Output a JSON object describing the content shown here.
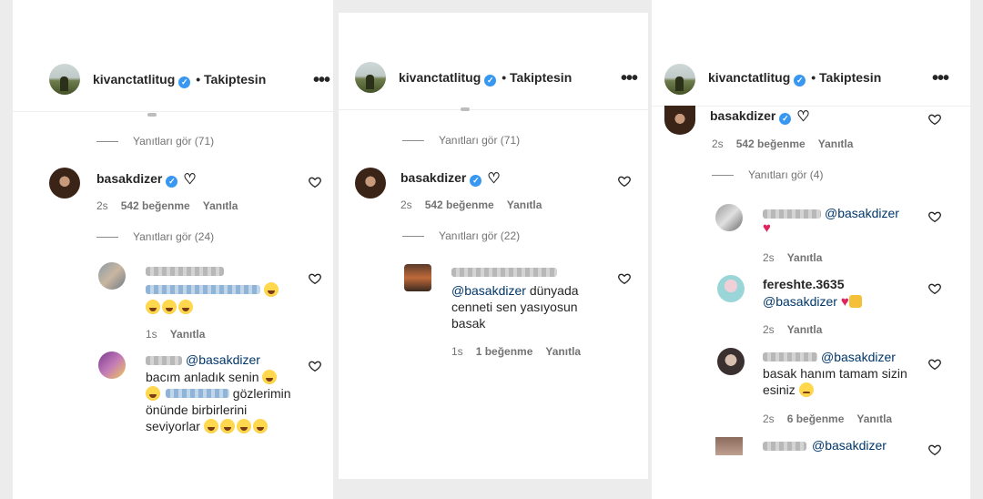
{
  "header": {
    "username": "kivanctatlitug",
    "follow_label": "• Takiptesin",
    "more_label": "•••"
  },
  "icons": {
    "verified": "verified-check-icon",
    "heart": "heart-outline-icon",
    "more": "more-dots-icon"
  },
  "panels": [
    {
      "top_replies": "Yanıtları gör (71)",
      "comment": {
        "username": "basakdizer",
        "time": "2s",
        "likes": "542 beğenme",
        "reply": "Yanıtla"
      },
      "replies_toggle": "Yanıtları gör (24)",
      "replies": [
        {
          "time": "1s",
          "reply": "Yanıtla"
        },
        {
          "mention": "@basakdizer",
          "line1": "bacım anladık senin",
          "line2": "gözlerimin",
          "line3": "önünde birbirlerini",
          "line4": "seviyorlar"
        }
      ]
    },
    {
      "top_replies": "Yanıtları gör (71)",
      "comment": {
        "username": "basakdizer",
        "time": "2s",
        "likes": "542 beğenme",
        "reply": "Yanıtla"
      },
      "replies_toggle": "Yanıtları gör (22)",
      "replies": [
        {
          "mention": "@basakdizer",
          "line1": "dünyada",
          "line2": "cenneti sen yasıyosun",
          "line3": "basak",
          "time": "1s",
          "likes": "1 beğenme",
          "reply": "Yanıtla"
        }
      ]
    },
    {
      "comment": {
        "username": "basakdizer",
        "time": "2s",
        "likes": "542 beğenme",
        "reply": "Yanıtla"
      },
      "replies_toggle": "Yanıtları gör (4)",
      "replies": [
        {
          "mention": "@basakdizer",
          "time": "2s",
          "reply": "Yanıtla"
        },
        {
          "username": "fereshte.3635",
          "mention": "@basakdizer",
          "time": "2s",
          "reply": "Yanıtla"
        },
        {
          "mention": "@basakdizer",
          "line1": "basak hanım tamam sizin",
          "line2": "esiniz",
          "time": "2s",
          "likes": "6 beğenme",
          "reply": "Yanıtla"
        },
        {
          "mention": "@basakdizer"
        }
      ]
    }
  ]
}
